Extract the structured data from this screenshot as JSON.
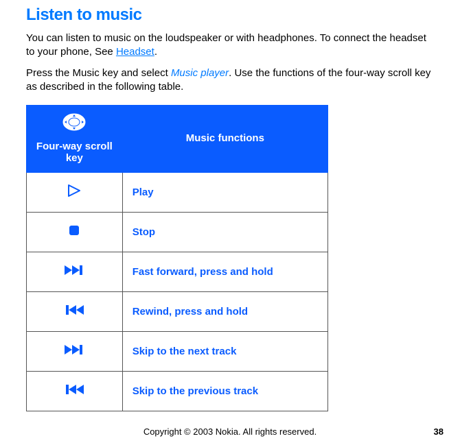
{
  "heading": "Listen to music",
  "para1_a": "You can listen to music on the loudspeaker or with headphones. To connect the headset to your phone, See ",
  "para1_link": "Headset",
  "para1_b": ".",
  "para2_a": "Press the Music key and select ",
  "para2_italic": "Music player",
  "para2_b": ". Use the functions of the four-way scroll key as described in the following table.",
  "table": {
    "header_col1": "Four-way scroll key",
    "header_col2": "Music functions",
    "rows": [
      {
        "fn": "Play"
      },
      {
        "fn": "Stop"
      },
      {
        "fn": "Fast forward, press and hold"
      },
      {
        "fn": "Rewind, press and hold"
      },
      {
        "fn": "Skip to the next track"
      },
      {
        "fn": "Skip to the previous track"
      }
    ]
  },
  "footer": "Copyright © 2003 Nokia. All rights reserved.",
  "page_number": "38"
}
